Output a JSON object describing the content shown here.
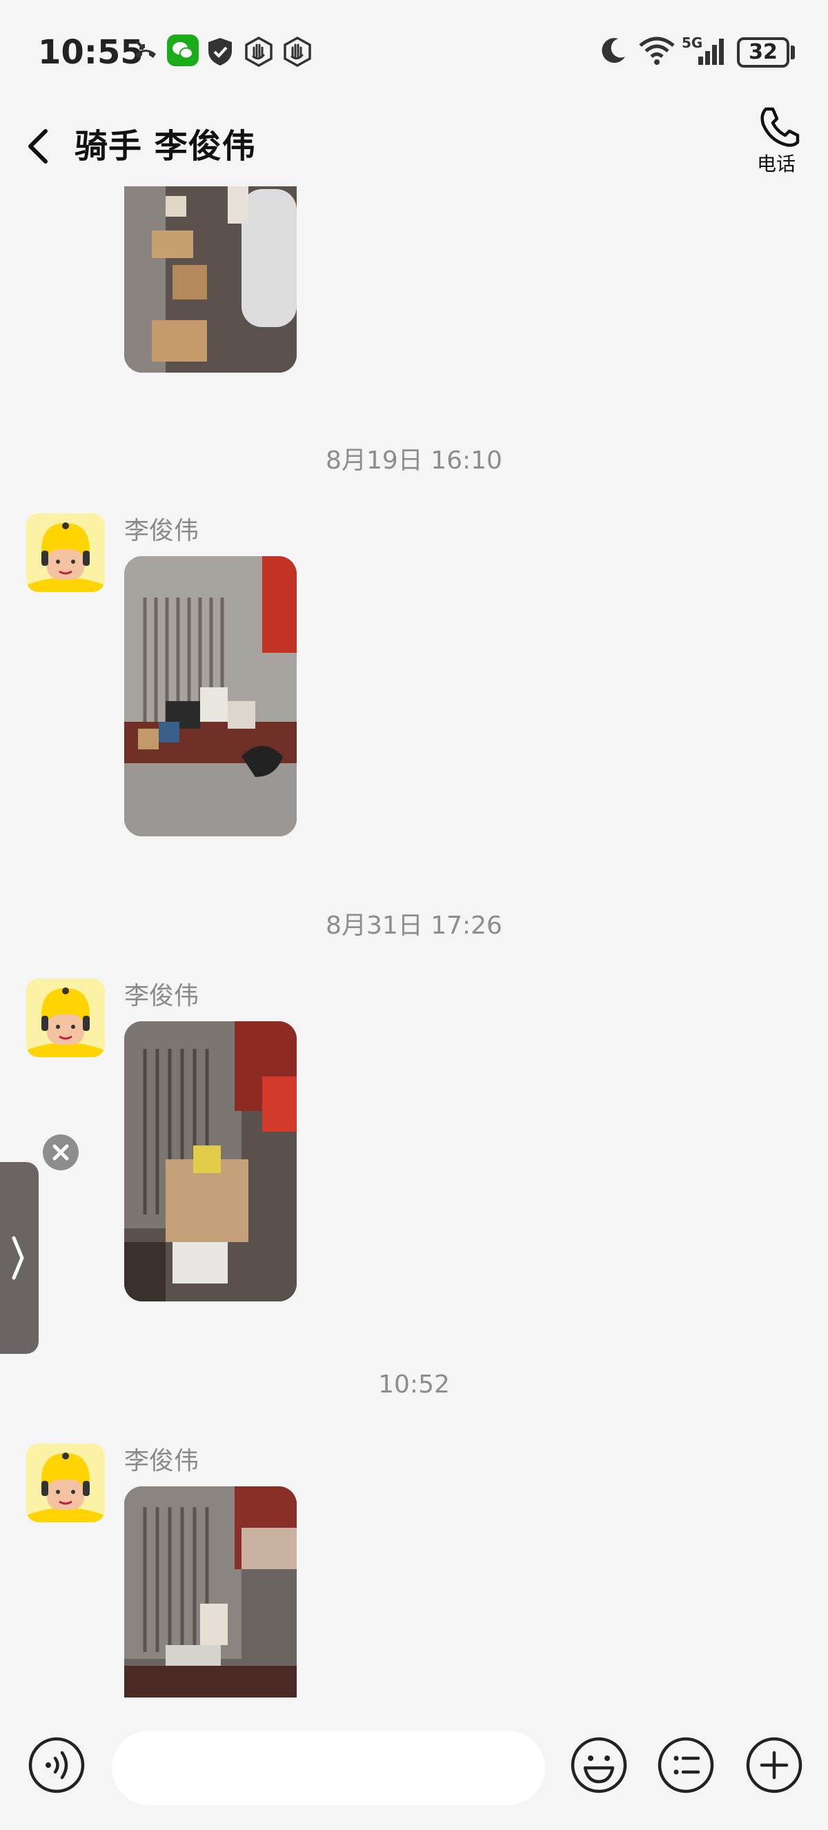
{
  "status_bar": {
    "time": "10:55",
    "battery_level": "32",
    "network": "5G",
    "icons": [
      "missed-call-icon",
      "wechat-icon",
      "shield-icon",
      "hand-icon",
      "hand-icon",
      "moon-icon",
      "wifi-icon",
      "signal-icon",
      "battery-icon"
    ]
  },
  "header": {
    "title": "骑手 李俊伟",
    "phone_label": "电话"
  },
  "messages": [
    {
      "type": "image",
      "sender": ""
    },
    {
      "type": "timestamp",
      "text": "8月19日 16:10"
    },
    {
      "type": "image",
      "sender": "李俊伟"
    },
    {
      "type": "timestamp",
      "text": "8月31日 17:26"
    },
    {
      "type": "image",
      "sender": "李俊伟"
    },
    {
      "type": "timestamp",
      "text": "10:52"
    },
    {
      "type": "image",
      "sender": "李俊伟"
    }
  ],
  "input": {
    "value": "",
    "placeholder": ""
  },
  "colors": {
    "background": "#f5f5f5",
    "timestamp_text": "#8d8d8d",
    "avatar_bg": "#fbf2a6",
    "helmet": "#ffd400",
    "icon_stroke": "#222222"
  }
}
